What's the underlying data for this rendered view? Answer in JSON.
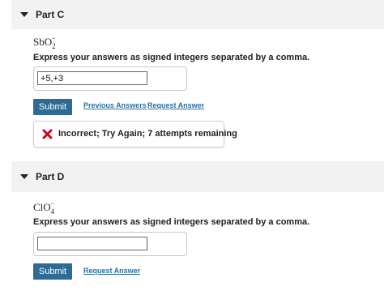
{
  "parts": [
    {
      "title": "Part C",
      "formula": {
        "base": "SbO",
        "sub": "2",
        "sup": "−"
      },
      "instructions": "Express your answers as signed integers separated by a comma.",
      "input": {
        "value": "+5,+3",
        "placeholder": ""
      },
      "submit_label": "Submit",
      "links": {
        "previous_answers": "Previous Answers",
        "request_answer": "Request Answer"
      },
      "feedback": {
        "text": "Incorrect; Try Again; 7 attempts remaining",
        "icon": "x-icon",
        "icon_color": "#d0021b"
      }
    },
    {
      "title": "Part D",
      "formula": {
        "base": "ClO",
        "sub": "4",
        "sup": "−"
      },
      "instructions": "Express your answers as signed integers separated by a comma.",
      "input": {
        "value": "",
        "placeholder": ""
      },
      "submit_label": "Submit",
      "links": {
        "request_answer": "Request Answer"
      }
    }
  ],
  "colors": {
    "header_bg": "#f2f2f2",
    "button_bg": "#2d6a94",
    "link": "#2a6f9e",
    "error": "#d0021b"
  }
}
